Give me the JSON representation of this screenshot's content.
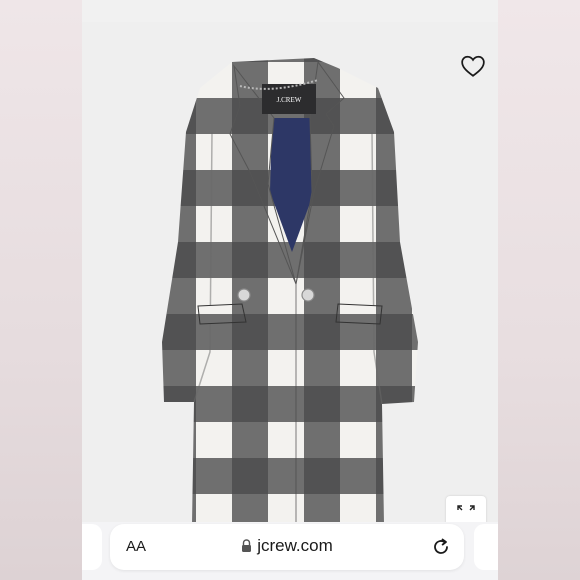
{
  "toolbar": {
    "text_size_label": "AA",
    "url": "jcrew.com"
  },
  "product_image": {
    "brand_label": "J.CREW"
  },
  "icons": {
    "favorite": "heart-icon",
    "expand": "expand-icon",
    "lock": "lock-icon",
    "reload": "reload-icon"
  },
  "colors": {
    "plaid_dark": "#3f3f41",
    "plaid_light": "#f4f3f1",
    "lining": "#2d3766"
  }
}
